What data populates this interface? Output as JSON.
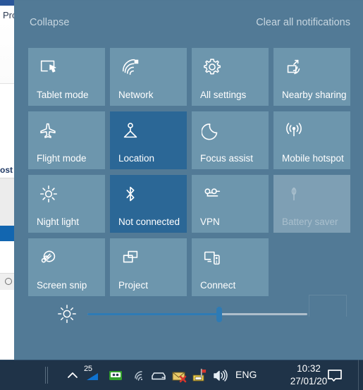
{
  "background_window": {
    "title_fragment": "Pro",
    "section_fragment": "ost"
  },
  "action_center": {
    "collapse_label": "Collapse",
    "clear_label": "Clear all notifications",
    "accent_color": "#2b6796",
    "panel_color": "#517a96",
    "tile_color": "#6d96ad",
    "tiles": [
      {
        "label": "Tablet mode",
        "icon": "tablet-mode-icon",
        "state": "off"
      },
      {
        "label": "Network",
        "icon": "network-icon",
        "state": "off"
      },
      {
        "label": "All settings",
        "icon": "gear-icon",
        "state": "off"
      },
      {
        "label": "Nearby sharing",
        "icon": "nearby-sharing-icon",
        "state": "off"
      },
      {
        "label": "Flight mode",
        "icon": "airplane-icon",
        "state": "off"
      },
      {
        "label": "Location",
        "icon": "location-icon",
        "state": "on"
      },
      {
        "label": "Focus assist",
        "icon": "moon-icon",
        "state": "off"
      },
      {
        "label": "Mobile hotspot",
        "icon": "hotspot-icon",
        "state": "off"
      },
      {
        "label": "Night light",
        "icon": "sun-icon",
        "state": "off"
      },
      {
        "label": "Not connected",
        "icon": "bluetooth-icon",
        "state": "on"
      },
      {
        "label": "VPN",
        "icon": "vpn-icon",
        "state": "off"
      },
      {
        "label": "Battery saver",
        "icon": "battery-leaf-icon",
        "state": "disabled"
      },
      {
        "label": "Screen snip",
        "icon": "screen-snip-icon",
        "state": "off"
      },
      {
        "label": "Project",
        "icon": "project-icon",
        "state": "off"
      },
      {
        "label": "Connect",
        "icon": "connect-icon",
        "state": "off"
      }
    ],
    "brightness": {
      "icon": "brightness-icon",
      "value_percent": 60
    }
  },
  "taskbar": {
    "chevron_icon": "chevron-up-icon",
    "battery_level": "25",
    "language": "ENG",
    "time": "10:32",
    "date": "27/01/20",
    "icons": [
      "battery-icon",
      "device-icon",
      "wifi-icon",
      "disk-icon",
      "mail-error-icon",
      "mail-flag-icon",
      "volume-icon"
    ],
    "action_center_icon": "action-center-icon"
  }
}
